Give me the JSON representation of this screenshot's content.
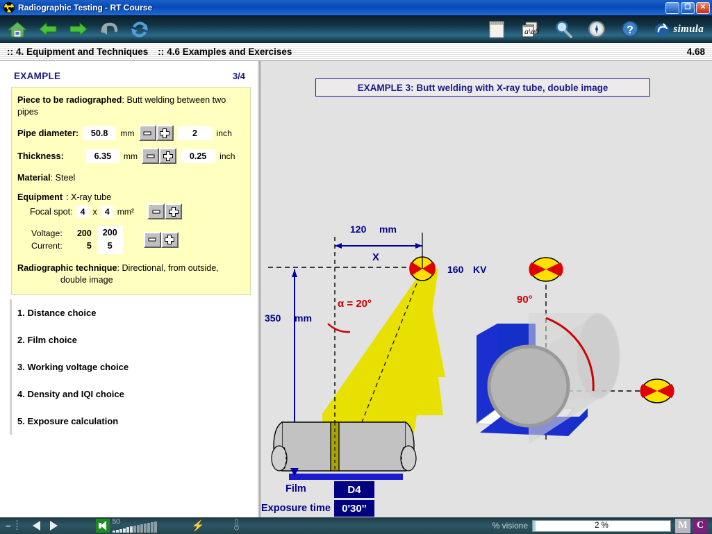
{
  "window": {
    "title": "Radiographic Testing - RT Course",
    "icon": "radiation-icon",
    "minimize": "_",
    "maximize": "❐",
    "close": "✕"
  },
  "toolbar": {
    "home": "home-icon",
    "back": "back-arrow-icon",
    "forward": "forward-arrow-icon",
    "undo": "undo-icon",
    "refresh": "refresh-icon",
    "notes": "notepad-icon",
    "glossary": "glossary-ab-icon",
    "search": "magnifier-icon",
    "compass": "compass-icon",
    "help": "help-icon",
    "brand": "simula"
  },
  "breadcrumb": {
    "sep": "::",
    "level1": "4. Equipment and Techniques",
    "level2": "4.6 Examples and Exercises",
    "version": "4.68"
  },
  "left_panel": {
    "heading": "EXAMPLE",
    "page": "3/4",
    "piece_label": "Piece to be radiographed",
    "piece_value": ": Butt welding between two pipes",
    "pipe_diameter_label": "Pipe diameter:",
    "pipe_diameter_mm": "50.8",
    "pipe_diameter_mm_unit": "mm",
    "pipe_diameter_inch": "2",
    "pipe_diameter_inch_unit": "inch",
    "thickness_label": "Thickness:",
    "thickness_mm": "6.35",
    "thickness_mm_unit": "mm",
    "thickness_inch": "0.25",
    "thickness_inch_unit": "inch",
    "material_label": "Material",
    "material_value": ": Steel",
    "equipment_label": "Equipment",
    "equipment_value": ":  X-ray tube",
    "focal_spot_label": "Focal spot:",
    "focal_x": "4",
    "focal_times": "x",
    "focal_y": "4",
    "focal_unit": "mm²",
    "voltage_label": "Voltage:",
    "current_label": "Current:",
    "voltage_value": "200",
    "current_value": "5",
    "voltage_field": "200",
    "current_field": "5",
    "technique_label": "Radiographic technique",
    "technique_value": ": Directional, from outside,",
    "technique_value2": "double image",
    "minus_glyph": "−",
    "plus_glyph": "+",
    "steps": [
      "1. Distance choice",
      "2. Film choice",
      "3. Working voltage choice",
      "4. Density and IQI choice",
      "5. Exposure calculation"
    ]
  },
  "diagram": {
    "banner": "EXAMPLE 3: Butt welding with X-ray tube, double image",
    "dim_120": "120",
    "dim_120_unit": "mm",
    "dim_x": "X",
    "kv_value": "160",
    "kv_unit": "KV",
    "alpha": "α = 20°",
    "dim_350": "350",
    "dim_350_unit": "mm",
    "angle_90": "90°",
    "film_label": "Film",
    "film_value": "D4",
    "exposure_label": "Exposure time",
    "exposure_value": "0'30''"
  },
  "statusbar": {
    "minus": "−",
    "prev": "prev-icon",
    "next": "next-icon",
    "volume": "50",
    "bolt": "⚡",
    "thermo": "thermometer-icon",
    "vision_label": "% visione",
    "vision_value": "2 %",
    "vision_percent": 2,
    "btn_m": "M",
    "btn_c": "C"
  },
  "colors": {
    "titlebar": "#0a47b0",
    "accent_blue": "#1a1a8c",
    "beam_yellow": "#e8e000",
    "note_bg": "#ffffc0",
    "source_red": "#e00000",
    "source_yellow": "#ffe000",
    "pipe_gray": "#c0c0c0",
    "film_blue": "#1a1ad0"
  }
}
